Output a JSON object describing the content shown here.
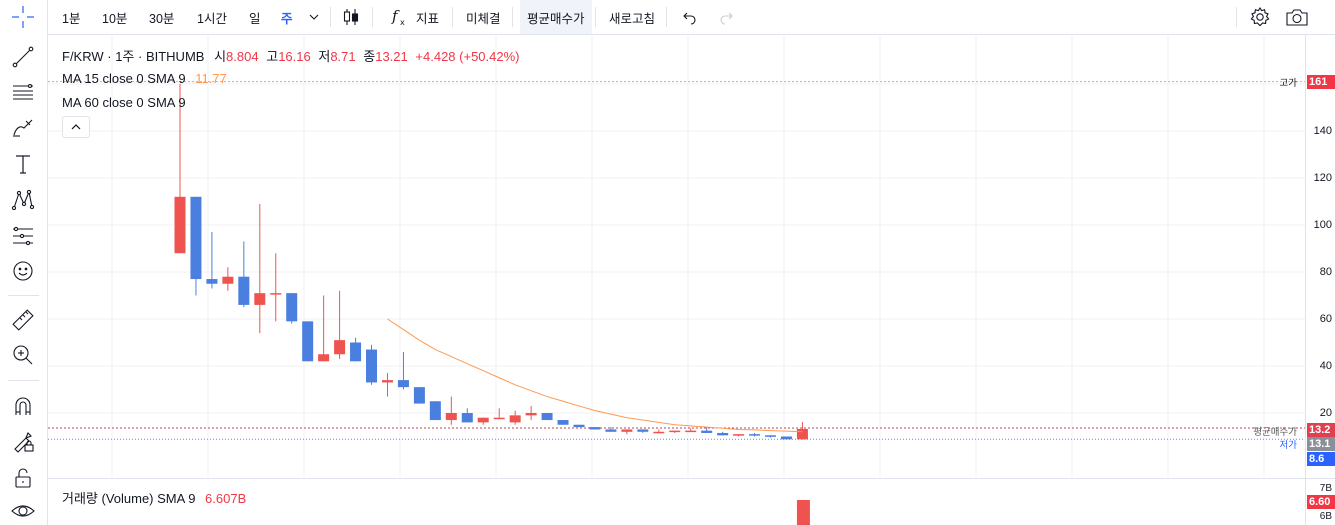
{
  "toolbar": {
    "intervals": [
      "1분",
      "10분",
      "30분",
      "1시간",
      "일",
      "주"
    ],
    "active_interval": "주",
    "indicator_label": "지표",
    "unfilled_label": "미체결",
    "avg_buy_label": "평균매수가",
    "refresh_label": "새로고침"
  },
  "legend": {
    "symbol": "F/KRW · 1주 · BITHUMB",
    "open_label": "시",
    "open": "8.804",
    "high_label": "고",
    "high": "16.16",
    "low_label": "저",
    "low": "8.71",
    "close_label": "종",
    "close": "13.21",
    "change": "+4.428 (+50.42%)",
    "ma15_label": "MA 15 close 0 SMA 9",
    "ma15_value": "11.77",
    "ma60_label": "MA 60 close 0 SMA 9",
    "volume_label": "거래량 (Volume) SMA 9",
    "volume_value": "6.607B"
  },
  "price_axis": {
    "ticks": [
      "140",
      "120",
      "100",
      "80",
      "60",
      "40",
      "20"
    ],
    "high_tag": "161",
    "avg_tag": "13.2",
    "low_tag": "13.1",
    "last_tag": "8.6",
    "volume_ticks": [
      "7B",
      "6B"
    ],
    "volume_tag": "6.60"
  },
  "lines": {
    "high_label": "고가",
    "avg_label": "평균매수가",
    "low_label": "저가"
  },
  "colors": {
    "up": "#ef5350",
    "down": "#4a7fdf",
    "ma": "#ff9850",
    "high_line": "#f0a080",
    "avg_line": "#c04050",
    "low_line": "#5a8ee0"
  },
  "chart_data": {
    "type": "candlestick",
    "y_scale": "linear",
    "ylim": [
      5,
      175
    ],
    "candles": [
      {
        "o": 88,
        "h": 160,
        "l": 88,
        "c": 112
      },
      {
        "o": 112,
        "h": 112,
        "l": 70,
        "c": 77
      },
      {
        "o": 77,
        "h": 97,
        "l": 73,
        "c": 75
      },
      {
        "o": 75,
        "h": 82,
        "l": 72,
        "c": 78
      },
      {
        "o": 78,
        "h": 93,
        "l": 65,
        "c": 66
      },
      {
        "o": 66,
        "h": 109,
        "l": 54,
        "c": 71
      },
      {
        "o": 71,
        "h": 88,
        "l": 59,
        "c": 71
      },
      {
        "o": 71,
        "h": 71,
        "l": 58,
        "c": 59
      },
      {
        "o": 59,
        "h": 59,
        "l": 42,
        "c": 42
      },
      {
        "o": 42,
        "h": 70,
        "l": 42,
        "c": 45
      },
      {
        "o": 45,
        "h": 72,
        "l": 43,
        "c": 51
      },
      {
        "o": 50,
        "h": 52,
        "l": 42,
        "c": 42
      },
      {
        "o": 47,
        "h": 49,
        "l": 32,
        "c": 33
      },
      {
        "o": 33,
        "h": 37,
        "l": 27,
        "c": 34
      },
      {
        "o": 34,
        "h": 46,
        "l": 30,
        "c": 31
      },
      {
        "o": 31,
        "h": 31,
        "l": 24,
        "c": 24
      },
      {
        "o": 25,
        "h": 25,
        "l": 17,
        "c": 17
      },
      {
        "o": 17,
        "h": 27,
        "l": 15,
        "c": 20
      },
      {
        "o": 20,
        "h": 22,
        "l": 16,
        "c": 16
      },
      {
        "o": 16,
        "h": 18,
        "l": 15,
        "c": 18
      },
      {
        "o": 18,
        "h": 22,
        "l": 18,
        "c": 18
      },
      {
        "o": 16,
        "h": 21,
        "l": 15,
        "c": 19
      },
      {
        "o": 19,
        "h": 23,
        "l": 17,
        "c": 20
      },
      {
        "o": 20,
        "h": 20,
        "l": 17,
        "c": 17
      },
      {
        "o": 17,
        "h": 17,
        "l": 15,
        "c": 15
      },
      {
        "o": 15,
        "h": 15,
        "l": 14,
        "c": 14
      },
      {
        "o": 14,
        "h": 14,
        "l": 13,
        "c": 13
      },
      {
        "o": 13,
        "h": 14,
        "l": 12,
        "c": 12
      },
      {
        "o": 12,
        "h": 13,
        "l": 11,
        "c": 13
      },
      {
        "o": 13,
        "h": 13,
        "l": 11.5,
        "c": 12
      },
      {
        "o": 12,
        "h": 13,
        "l": 11.5,
        "c": 12
      },
      {
        "o": 12,
        "h": 12.5,
        "l": 11.5,
        "c": 12.5
      },
      {
        "o": 12.5,
        "h": 13.5,
        "l": 12,
        "c": 12.5
      },
      {
        "o": 12.5,
        "h": 14,
        "l": 12,
        "c": 11.5
      },
      {
        "o": 11.5,
        "h": 12,
        "l": 10.5,
        "c": 10.5
      },
      {
        "o": 10.5,
        "h": 11,
        "l": 10,
        "c": 11
      },
      {
        "o": 11,
        "h": 11.5,
        "l": 10,
        "c": 10.5
      },
      {
        "o": 10.5,
        "h": 10.5,
        "l": 9.5,
        "c": 10
      },
      {
        "o": 10,
        "h": 10,
        "l": 8.7,
        "c": 8.8
      },
      {
        "o": 8.8,
        "h": 16.16,
        "l": 8.71,
        "c": 13.21
      }
    ],
    "ma_line": [
      60,
      55.5,
      51,
      47,
      44,
      41,
      38,
      35,
      32,
      29.5,
      27,
      25,
      23,
      21,
      19.5,
      18,
      17,
      16,
      15,
      14.5,
      14,
      13.5,
      13,
      12.8,
      12.5,
      12.3,
      12
    ],
    "volume_last": 6.607
  }
}
